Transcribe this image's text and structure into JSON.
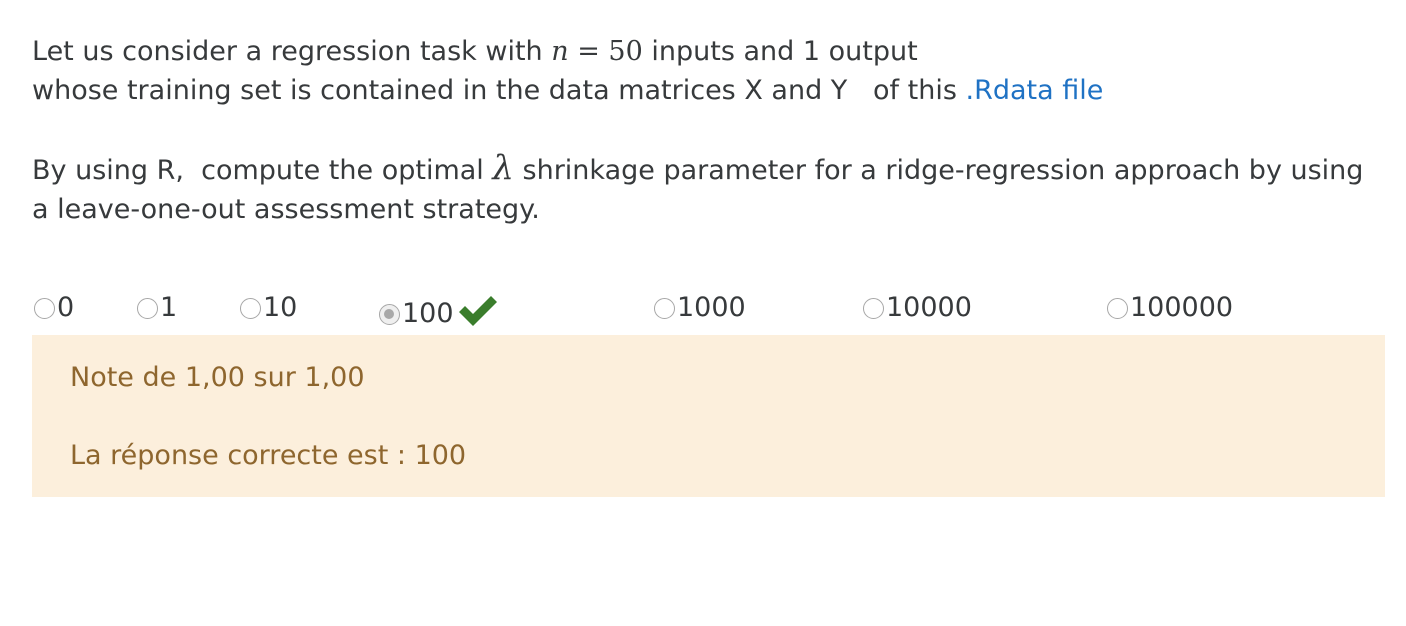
{
  "question": {
    "line1_prefix": "Let us consider a regression task with ",
    "math_n_var": "n",
    "math_n_equals": " = ",
    "math_n_value": "50",
    "line1_suffix": " inputs and 1 output",
    "line2_prefix": "whose training set is contained in the data matrices X and Y   of this ",
    "link_text": ".Rdata file",
    "para2_prefix": "By using R,  compute the optimal ",
    "math_lambda": "λ",
    "para2_suffix": " shrinkage parameter for a ridge-regression approach by using a leave-one-out assessment strategy."
  },
  "answers": {
    "options": [
      "0",
      "1",
      "10",
      "100",
      "1000",
      "10000",
      "100000"
    ],
    "selected": "100"
  },
  "feedback": {
    "grade": "Note de 1,00 sur 1,00",
    "correct_answer": "La réponse correcte est : 100",
    "background_color": "#fcefdc",
    "text_color": "#8e662e"
  },
  "colors": {
    "link": "#1f72c4",
    "check_mark": "#3a7d2c"
  },
  "icons": {
    "check": "check-icon"
  }
}
